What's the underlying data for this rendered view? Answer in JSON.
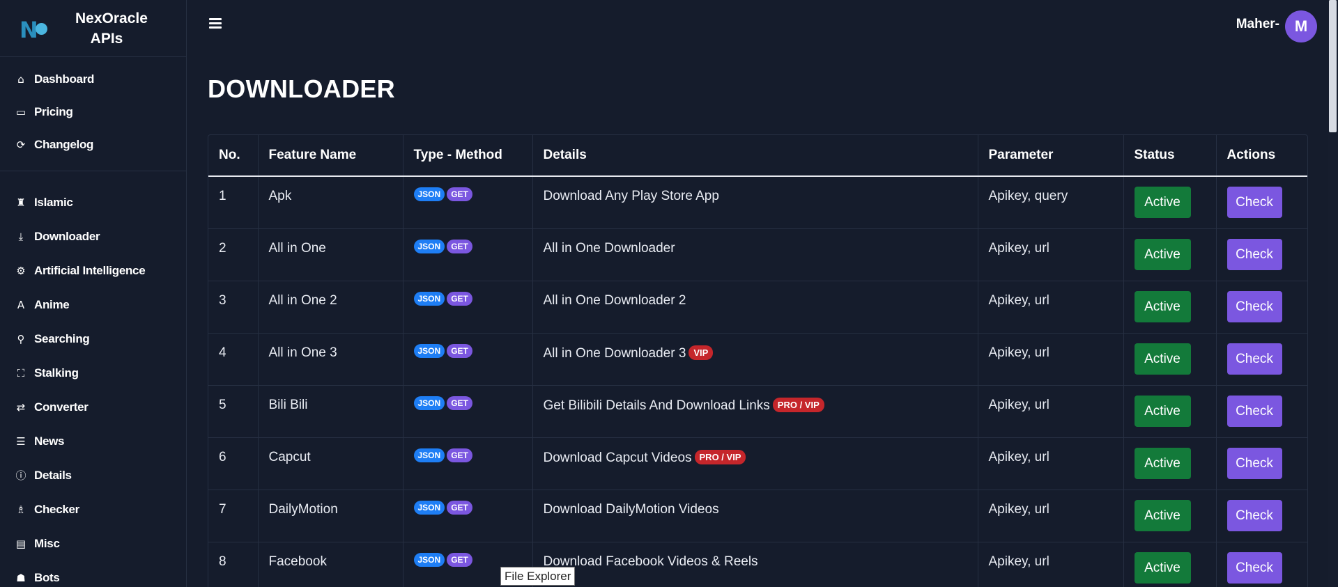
{
  "brand": {
    "logo_text": "No",
    "name": "NexOracle APIs"
  },
  "sidebar": {
    "primary": [
      {
        "label": "Dashboard",
        "icon": "home-icon"
      },
      {
        "label": "Pricing",
        "icon": "credit-card-icon"
      },
      {
        "label": "Changelog",
        "icon": "sync-icon"
      }
    ],
    "categories": [
      {
        "label": "Islamic",
        "icon": "mosque-icon"
      },
      {
        "label": "Downloader",
        "icon": "download-icon"
      },
      {
        "label": "Artificial Intelligence",
        "icon": "robot-icon"
      },
      {
        "label": "Anime",
        "icon": "anime-icon"
      },
      {
        "label": "Searching",
        "icon": "search-icon"
      },
      {
        "label": "Stalking",
        "icon": "stalk-icon"
      },
      {
        "label": "Converter",
        "icon": "exchange-icon"
      },
      {
        "label": "News",
        "icon": "newspaper-icon"
      },
      {
        "label": "Details",
        "icon": "info-icon"
      },
      {
        "label": "Checker",
        "icon": "checker-icon"
      },
      {
        "label": "Misc",
        "icon": "misc-icon"
      },
      {
        "label": "Bots",
        "icon": "bot-icon"
      }
    ]
  },
  "header": {
    "user_name": "Maher-",
    "avatar_letter": "M"
  },
  "page": {
    "title": "DOWNLOADER"
  },
  "table": {
    "columns": [
      "No.",
      "Feature Name",
      "Type - Method",
      "Details",
      "Parameter",
      "Status",
      "Actions"
    ],
    "rows": [
      {
        "no": "1",
        "name": "Apk",
        "type": "JSON",
        "method": "GET",
        "details": "Download Any Play Store App",
        "tag": "",
        "param": "Apikey, query",
        "status": "Active",
        "action": "Check"
      },
      {
        "no": "2",
        "name": "All in One",
        "type": "JSON",
        "method": "GET",
        "details": "All in One Downloader",
        "tag": "",
        "param": "Apikey, url",
        "status": "Active",
        "action": "Check"
      },
      {
        "no": "3",
        "name": "All in One 2",
        "type": "JSON",
        "method": "GET",
        "details": "All in One Downloader 2",
        "tag": "",
        "param": "Apikey, url",
        "status": "Active",
        "action": "Check"
      },
      {
        "no": "4",
        "name": "All in One 3",
        "type": "JSON",
        "method": "GET",
        "details": "All in One Downloader 3",
        "tag": "VIP",
        "param": "Apikey, url",
        "status": "Active",
        "action": "Check"
      },
      {
        "no": "5",
        "name": "Bili Bili",
        "type": "JSON",
        "method": "GET",
        "details": "Get Bilibili Details And Download Links",
        "tag": "PRO / VIP",
        "param": "Apikey, url",
        "status": "Active",
        "action": "Check"
      },
      {
        "no": "6",
        "name": "Capcut",
        "type": "JSON",
        "method": "GET",
        "details": "Download Capcut Videos",
        "tag": "PRO / VIP",
        "param": "Apikey, url",
        "status": "Active",
        "action": "Check"
      },
      {
        "no": "7",
        "name": "DailyMotion",
        "type": "JSON",
        "method": "GET",
        "details": "Download DailyMotion Videos",
        "tag": "",
        "param": "Apikey, url",
        "status": "Active",
        "action": "Check"
      },
      {
        "no": "8",
        "name": "Facebook",
        "type": "JSON",
        "method": "GET",
        "details": "Download Facebook Videos & Reels",
        "tag": "",
        "param": "Apikey, url",
        "status": "Active",
        "action": "Check"
      }
    ]
  },
  "tooltip": {
    "text": "File Explorer"
  },
  "colors": {
    "background": "#151c2c",
    "json_badge": "#1e7ef5",
    "get_badge": "#7b57e0",
    "tag_badge": "#c5262b",
    "active_button": "#137a3a",
    "check_button": "#7b57e0"
  }
}
